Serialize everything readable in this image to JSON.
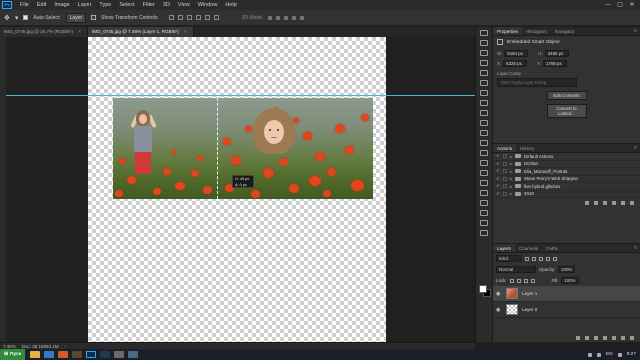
{
  "app": {
    "logo": "Ps"
  },
  "menu": [
    "File",
    "Edit",
    "Image",
    "Layer",
    "Type",
    "Select",
    "Filter",
    "3D",
    "View",
    "Window",
    "Help"
  ],
  "window_controls": {
    "minimize": "—",
    "maximize": "▢",
    "close": "✕"
  },
  "options": {
    "auto_select_label": "Auto-Select:",
    "auto_select_value": "Layer",
    "transform_label": "Show Transform Controls",
    "mode3d_label": "3D Mode:"
  },
  "tabs": [
    {
      "label": "IMG_0745.jpg @ 16.7% (RGB/8*)",
      "active": false
    },
    {
      "label": "IMG_0745.jpg @ 7.46% (Layer 1, RGB/8*)",
      "active": true
    }
  ],
  "tab_close": "×",
  "canvas": {
    "tooltip": {
      "line1": "H: 45 px",
      "line2": "Δ: 0 px"
    }
  },
  "status": {
    "zoom": "7.46%",
    "doc": "Doc: 28.1M/83.1M",
    "arrow": "›"
  },
  "properties": {
    "tabs": [
      "Properties",
      "Histogram",
      "Navigator"
    ],
    "menu": "≡",
    "title": "Embedded Smart Object",
    "w_label": "W:",
    "w_value": "5184 px",
    "h_label": "H:",
    "h_value": "3456 px",
    "x_label": "X:",
    "x_value": "6325 px",
    "y_label": "Y:",
    "y_value": "1768 px",
    "layer_comp_label": "Layer Comp",
    "layer_comp_placeholder": "Don't Apply Layer Comp",
    "btn_edit": "Edit Contents",
    "btn_convert": "Convert to Linked..."
  },
  "actions": {
    "tabs": [
      "Actions",
      "History"
    ],
    "menu": "≡",
    "items": [
      "Default Actions",
      "DOrlan",
      "Elia_Marasoff_Portrait",
      "Steve Perry's Web Sharpen",
      "five-hybrid glitches",
      "2018"
    ]
  },
  "layers": {
    "tabs": [
      "Layers",
      "Channels",
      "Paths"
    ],
    "menu": "≡",
    "kind_label": "Kind",
    "blend_mode": "Normal",
    "opacity_label": "Opacity:",
    "opacity_value": "100%",
    "lock_label": "Lock:",
    "fill_label": "Fill:",
    "fill_value": "100%",
    "items": [
      {
        "name": "Layer 1",
        "selected": true
      },
      {
        "name": "Layer 0",
        "selected": false
      }
    ]
  },
  "taskbar": {
    "start": "Пуск",
    "lang": "EN",
    "time": "9:27"
  }
}
